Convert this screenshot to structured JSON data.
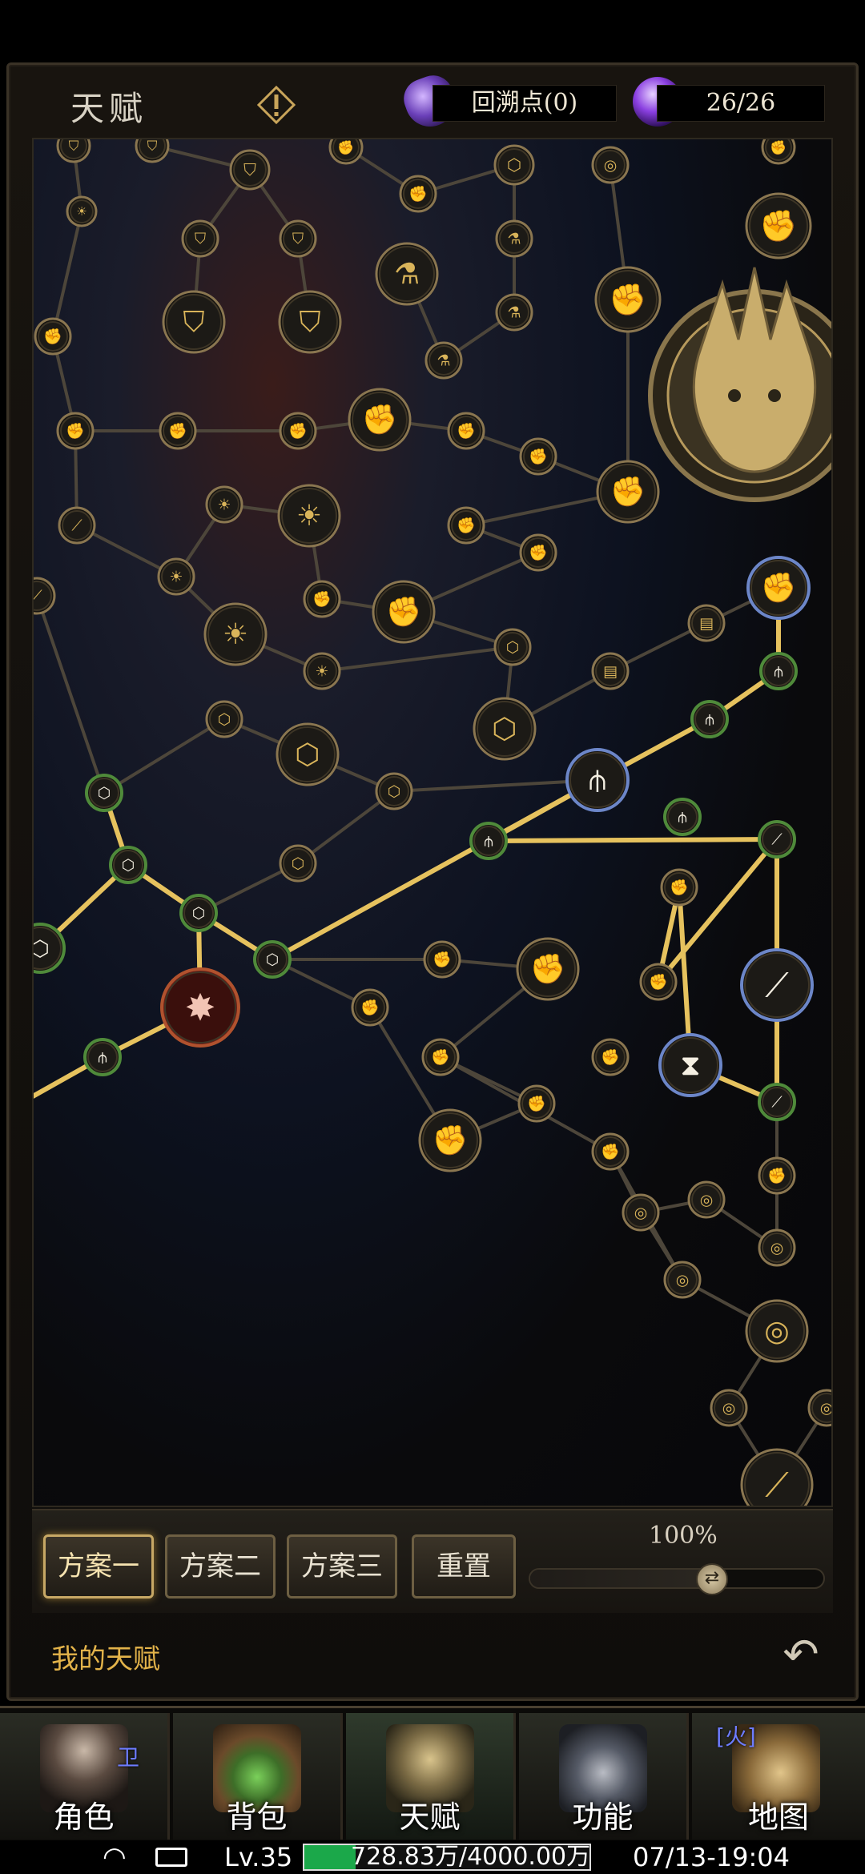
{
  "header": {
    "title": "天赋",
    "respec_points_label": "回溯点(0)",
    "talent_points": "26/26"
  },
  "plans": {
    "items": [
      "方案一",
      "方案二",
      "方案三"
    ],
    "active_index": 0,
    "reset_label": "重置"
  },
  "zoom": {
    "label": "100%",
    "level": 0.62
  },
  "footer": {
    "my_talent_label": "我的天赋"
  },
  "nav": {
    "items": [
      {
        "label": "角色",
        "badge": "卫"
      },
      {
        "label": "背包",
        "badge": ""
      },
      {
        "label": "天赋",
        "badge": ""
      },
      {
        "label": "功能",
        "badge": ""
      },
      {
        "label": "地图",
        "badge": "[火]"
      }
    ]
  },
  "status": {
    "level": "Lv.35",
    "exp_text": "728.83万/4000.00万",
    "exp_fraction": 0.18,
    "datetime": "07/13-19:04"
  },
  "colors": {
    "gold": "#d9b45a",
    "accent_text": "#e3b34a",
    "active_path": "#e6c25e",
    "inactive_path": "#4d463a"
  }
}
